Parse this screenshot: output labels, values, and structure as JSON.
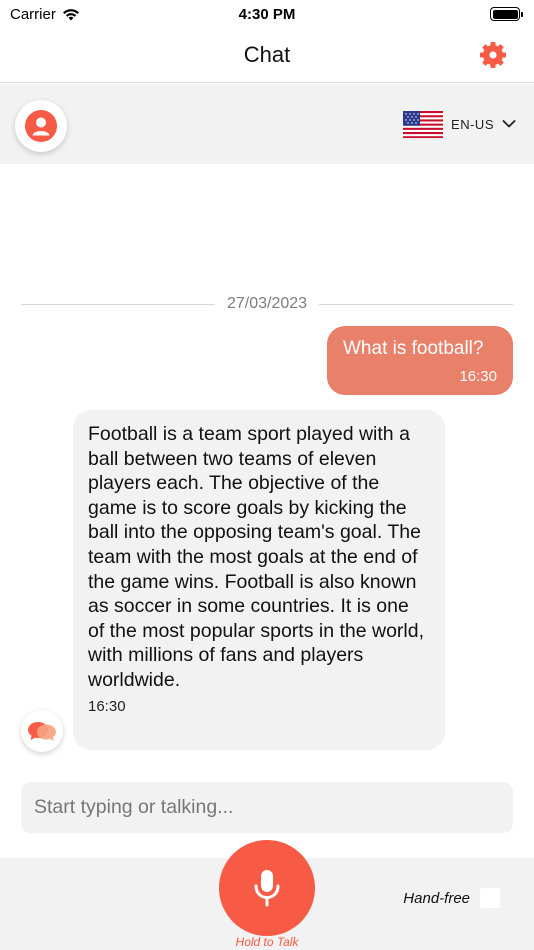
{
  "status": {
    "carrier": "Carrier",
    "time": "4:30 PM"
  },
  "nav": {
    "title": "Chat"
  },
  "language": {
    "code": "EN-US"
  },
  "conversation": {
    "date": "27/03/2023",
    "user_message": {
      "text": "What is football?",
      "time": "16:30"
    },
    "bot_message": {
      "text": "Football is a team sport played with a ball between two teams of eleven players each. The objective of the game is to score goals by kicking the ball into the opposing team's goal. The team with the most goals at the end of the game wins. Football is also known as soccer in some countries. It is one of the most popular sports in the world, with millions of fans and players worldwide.",
      "time": "16:30"
    }
  },
  "composer": {
    "placeholder": "Start typing or talking...",
    "value": ""
  },
  "controls": {
    "hold_to_talk": "Hold to Talk",
    "hands_free": "Hand-free"
  },
  "colors": {
    "accent": "#f75a45",
    "user_bubble": "#e9806a",
    "panel": "#f2f2f2"
  },
  "icons": [
    "wifi-icon",
    "battery-icon",
    "gear-icon",
    "user-icon",
    "us-flag-icon",
    "chevron-down-icon",
    "chat-bubbles-icon",
    "microphone-icon"
  ]
}
